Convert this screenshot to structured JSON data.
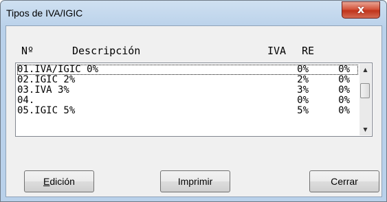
{
  "window": {
    "title": "Tipos de IVA/IGIC",
    "close_glyph": "x"
  },
  "columns": {
    "num": "Nº",
    "desc": "Descripción",
    "iva": "IVA",
    "re": "RE"
  },
  "rows": [
    {
      "desc": "01.IVA/IGIC 0%",
      "iva": "0%",
      "re": "0%",
      "selected": true
    },
    {
      "desc": "02.IGIC 2%",
      "iva": "2%",
      "re": "0%"
    },
    {
      "desc": "03.IVA 3%",
      "iva": "3%",
      "re": "0%"
    },
    {
      "desc": "04.",
      "iva": "0%",
      "re": "0%"
    },
    {
      "desc": "05.IGIC 5%",
      "iva": "5%",
      "re": "0%"
    }
  ],
  "buttons": {
    "edicion_first": "E",
    "edicion_rest": "dición",
    "imprimir": "Imprimir",
    "cerrar": "Cerrar"
  }
}
